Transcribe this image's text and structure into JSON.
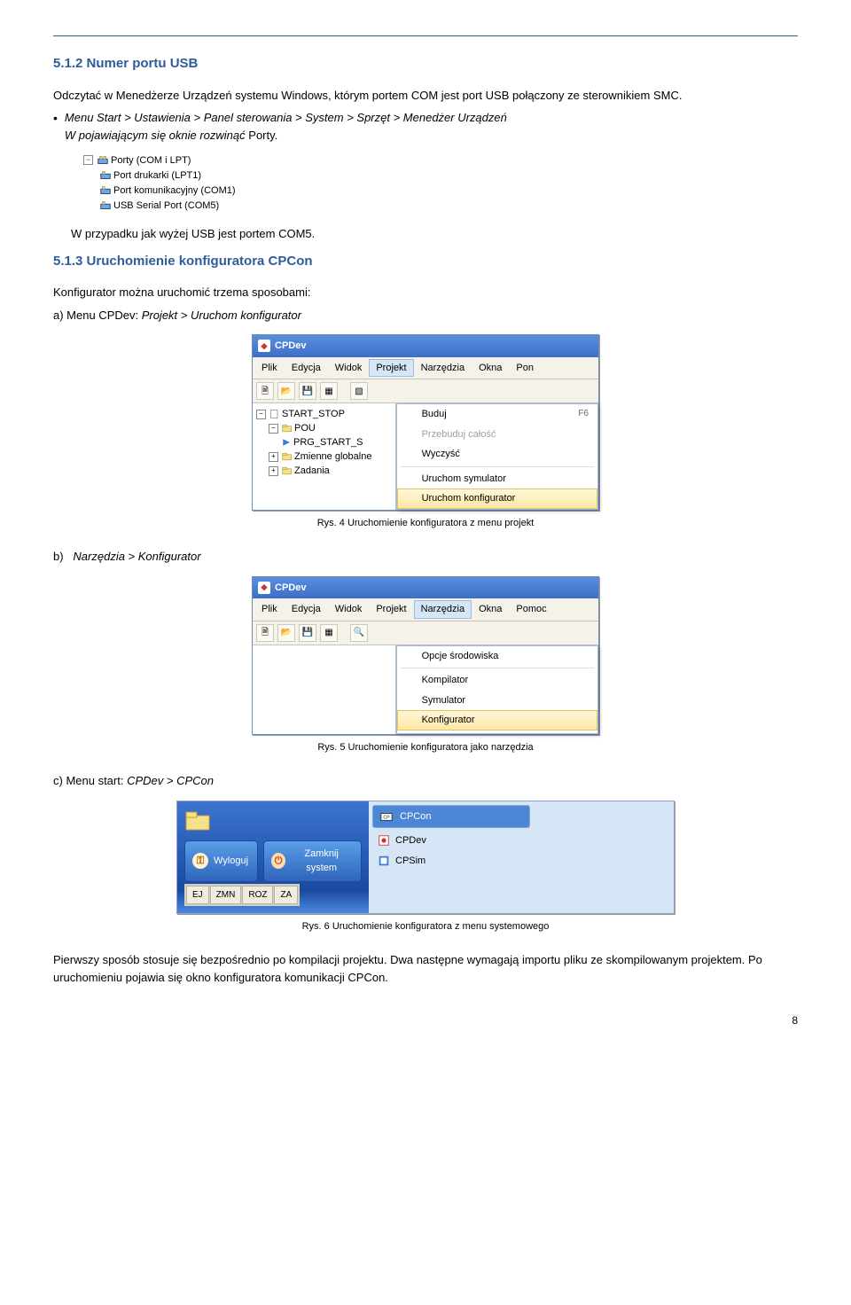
{
  "section1": {
    "heading": "5.1.2 Numer portu USB",
    "p1": "Odczytać w Menedżerze Urządzeń systemu Windows, którym portem COM jest port USB połączony ze sterownikiem SMC.",
    "bullet1_main": "Menu Start > Ustawienia > Panel sterowania > System > Sprzęt > Menedżer Urządzeń",
    "bullet1_sub": "W pojawiającym się oknie rozwinąć Porty.",
    "tree": {
      "root": "Porty (COM i LPT)",
      "items": [
        "Port drukarki (LPT1)",
        "Port komunikacyjny (COM1)",
        "USB Serial Port (COM5)"
      ]
    },
    "p2": "W przypadku jak wyżej USB jest portem COM5."
  },
  "section2": {
    "heading": "5.1.3 Uruchomienie konfiguratora CPCon",
    "p1": "Konfigurator można uruchomić trzema sposobami:",
    "item_a_prefix": "a)  Menu CPDev: ",
    "item_a_em": "Projekt > Uruchom konfigurator",
    "item_b_prefix": "b)",
    "item_b_em": "Narzędzia > Konfigurator",
    "item_c_prefix": "c)  Menu start: ",
    "item_c_em": "CPDev > CPCon"
  },
  "cpdev1": {
    "title": "CPDev",
    "menu": [
      "Plik",
      "Edycja",
      "Widok",
      "Projekt",
      "Narzędzia",
      "Okna",
      "Pon"
    ],
    "menu_active_idx": 3,
    "sidebar": [
      "START_STOP",
      "POU",
      "PRG_START_S",
      "Zmienne globalne",
      "Zadania"
    ],
    "popup": [
      {
        "label": "Buduj",
        "shortcut": "F6",
        "disabled": false
      },
      {
        "label": "Przebuduj całość",
        "shortcut": "",
        "disabled": true
      },
      {
        "label": "Wyczyść",
        "shortcut": "",
        "disabled": false
      },
      {
        "label": "Uruchom symulator",
        "shortcut": "",
        "disabled": false
      },
      {
        "label": "Uruchom konfigurator",
        "shortcut": "",
        "disabled": false,
        "hl": true
      }
    ]
  },
  "cap1": "Rys. 4 Uruchomienie konfiguratora z menu projekt",
  "cpdev2": {
    "title": "CPDev",
    "menu": [
      "Plik",
      "Edycja",
      "Widok",
      "Projekt",
      "Narzędzia",
      "Okna",
      "Pomoc"
    ],
    "menu_active_idx": 4,
    "popup": [
      {
        "label": "Opcje środowiska",
        "hl": false
      },
      {
        "label": "Kompilator",
        "hl": false
      },
      {
        "label": "Symulator",
        "hl": false
      },
      {
        "label": "Konfigurator",
        "hl": true
      }
    ]
  },
  "cap2": "Rys. 5 Uruchomienie konfiguratora jako narzędzia",
  "startmenu": {
    "left_buttons": [
      "Wyloguj",
      "Zamknij system"
    ],
    "chips": [
      "EJ",
      "ZMN",
      "ROZ",
      "ZA"
    ],
    "right": [
      "CPCon",
      "CPDev",
      "CPSim"
    ]
  },
  "cap3": "Rys. 6 Uruchomienie konfiguratora z menu systemowego",
  "closing": "Pierwszy sposób stosuje się bezpośrednio po kompilacji projektu. Dwa następne wymagają importu pliku ze skompilowanym projektem. Po uruchomieniu pojawia się okno konfiguratora komunikacji CPCon.",
  "page": "8"
}
